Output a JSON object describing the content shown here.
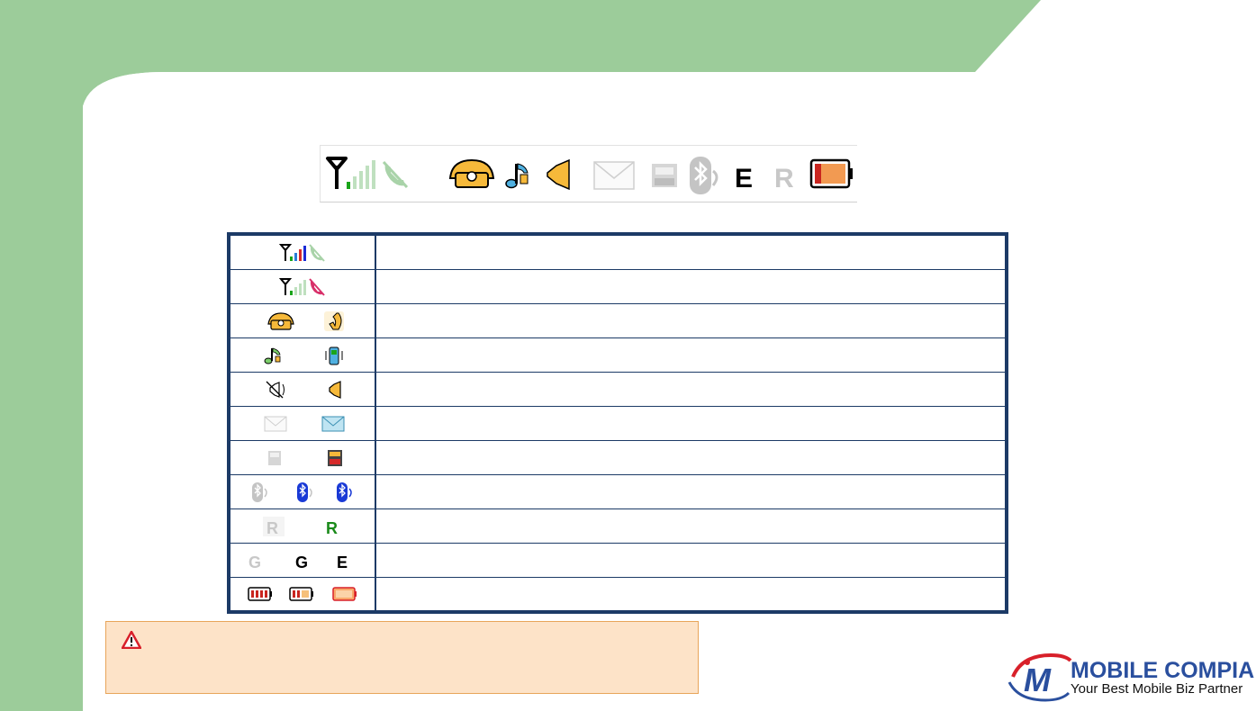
{
  "colors": {
    "frame_green": "#9ccc9a",
    "table_border": "#1c3a66",
    "caution_fill": "#fde3c8",
    "caution_border": "#e8a55a",
    "logo_blue": "#2a4f9e",
    "logo_red": "#d8202a"
  },
  "status_strip": {
    "icons": [
      "antenna-icon",
      "signal-bars-icon",
      "no-service-icon",
      "phone-icon",
      "music-note-icon",
      "speaker-icon",
      "envelope-icon",
      "all-calls-icon",
      "bluetooth-icon",
      "edge-icon",
      "roaming-icon",
      "battery-icon"
    ],
    "edge_letter": "E",
    "roaming_letter": "R"
  },
  "legend": {
    "rows": [
      {
        "icons": [
          "signal-strength-icon",
          "no-service-icon"
        ],
        "description": ""
      },
      {
        "icons": [
          "weak-signal-icon",
          "no-service-red-icon"
        ],
        "description": ""
      },
      {
        "icons": [
          "phone-icon",
          "call-handset-icon"
        ],
        "description": ""
      },
      {
        "icons": [
          "ring-tone-icon",
          "vibrate-icon"
        ],
        "description": ""
      },
      {
        "icons": [
          "speaker-mute-icon",
          "speaker-icon"
        ],
        "description": ""
      },
      {
        "icons": [
          "envelope-empty-icon",
          "envelope-new-icon"
        ],
        "description": ""
      },
      {
        "icons": [
          "all-calls-off-icon",
          "all-calls-on-icon"
        ],
        "description": ""
      },
      {
        "icons": [
          "bluetooth-off-icon",
          "bluetooth-on-icon",
          "bluetooth-connected-icon"
        ],
        "description": ""
      },
      {
        "icons": [
          "roaming-off-icon",
          "roaming-on-icon"
        ],
        "description": ""
      },
      {
        "icons": [
          "gprs-off-icon",
          "gprs-on-icon",
          "edge-icon"
        ],
        "description": ""
      },
      {
        "icons": [
          "battery-full-icon",
          "battery-half-icon",
          "battery-low-icon"
        ],
        "description": ""
      }
    ],
    "letters": {
      "gprs": "G",
      "edge": "E",
      "roaming": "R"
    }
  },
  "caution": {
    "icon": "warning-triangle-icon",
    "text": ""
  },
  "logo": {
    "monogram": "M",
    "name": "MOBILE COMPIA",
    "tagline": "Your Best Mobile Biz Partner"
  }
}
